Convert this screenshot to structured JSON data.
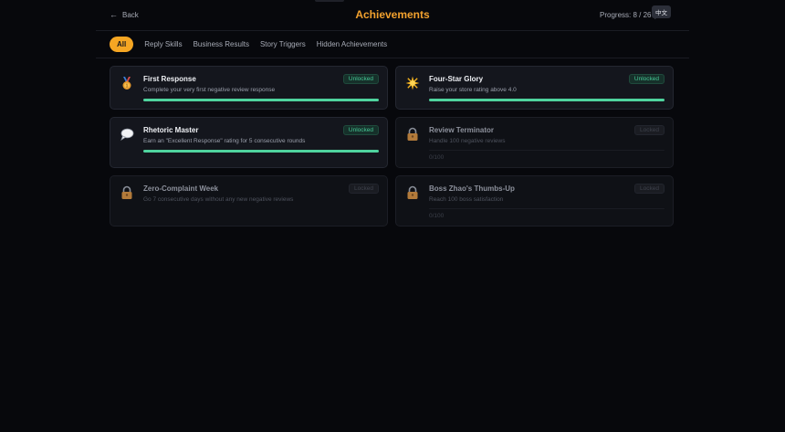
{
  "header": {
    "back_label": "Back",
    "title": "Achievements",
    "progress_label": "Progress: 8 / 26 (",
    "language_label": "中文"
  },
  "tabs": [
    {
      "label": "All",
      "active": true
    },
    {
      "label": "Reply Skills",
      "active": false
    },
    {
      "label": "Business Results",
      "active": false
    },
    {
      "label": "Story Triggers",
      "active": false
    },
    {
      "label": "Hidden Achievements",
      "active": false
    }
  ],
  "achievements": [
    {
      "name": "First Response",
      "description": "Complete your very first negative review response",
      "status": "Unlocked",
      "icon": "medal-icon",
      "progress": 1.0
    },
    {
      "name": "Four-Star Glory",
      "description": "Raise your store rating above 4.0",
      "status": "Unlocked",
      "icon": "sparkle-star-icon",
      "progress": 1.0
    },
    {
      "name": "Rhetoric Master",
      "description": "Earn an \"Excellent Response\" rating for 5 consecutive rounds",
      "status": "Unlocked",
      "icon": "speech-bubble-icon",
      "progress": 1.0
    },
    {
      "name": "Review Terminator",
      "description": "Handle 100 negative reviews",
      "status": "Locked",
      "icon": "lock-icon",
      "progress": 0.0,
      "count": "0/100"
    },
    {
      "name": "Zero-Complaint Week",
      "description": "Go 7 consecutive days without any new negative reviews",
      "status": "Locked",
      "icon": "lock-icon",
      "progress": 0.0
    },
    {
      "name": "Boss Zhao's Thumbs-Up",
      "description": "Reach 100 boss satisfaction",
      "status": "Locked",
      "icon": "lock-icon",
      "progress": 0.0,
      "count": "0/100"
    }
  ],
  "colors": {
    "accent": "#f5a623",
    "unlocked": "#46c896",
    "progress_fill": "#4fd39e",
    "background": "#07080c"
  }
}
